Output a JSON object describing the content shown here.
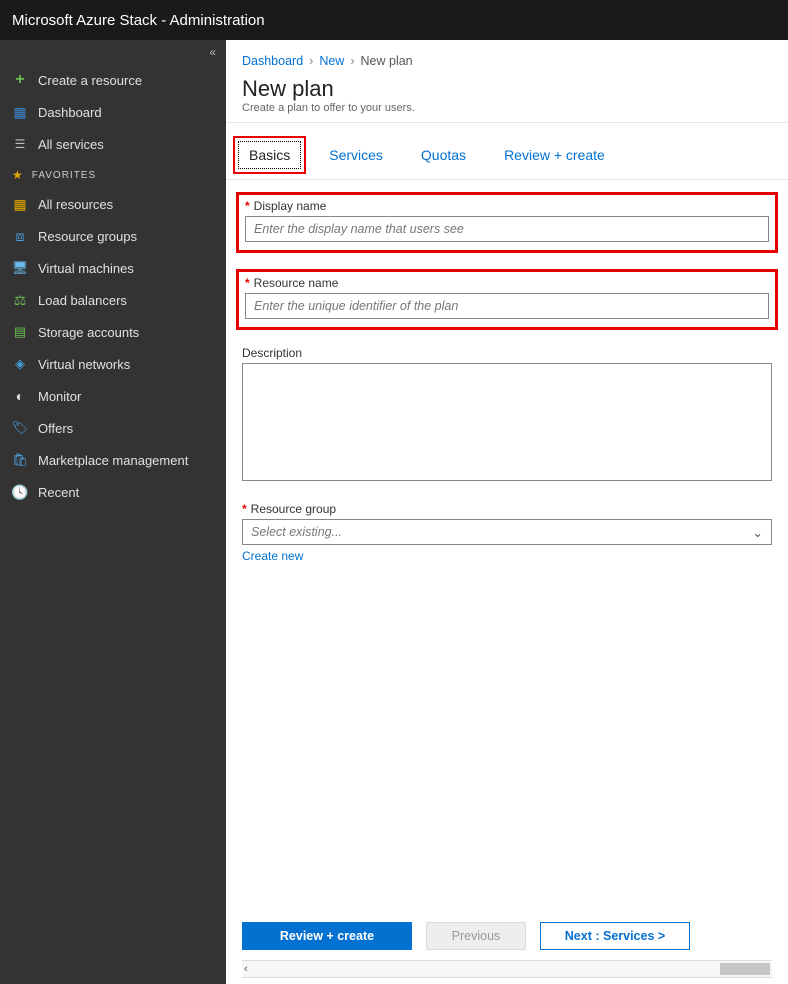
{
  "app_title": "Microsoft Azure Stack - Administration",
  "sidebar": {
    "create_label": "Create a resource",
    "dashboard_label": "Dashboard",
    "all_services_label": "All services",
    "favorites_header": "FAVORITES",
    "items": [
      "All resources",
      "Resource groups",
      "Virtual machines",
      "Load balancers",
      "Storage accounts",
      "Virtual networks",
      "Monitor",
      "Offers",
      "Marketplace management",
      "Recent"
    ]
  },
  "breadcrumb": {
    "root": "Dashboard",
    "mid": "New",
    "current": "New plan"
  },
  "title": "New plan",
  "subtitle": "Create a plan to offer to your users.",
  "tabs": {
    "basics": "Basics",
    "services": "Services",
    "quotas": "Quotas",
    "review": "Review + create"
  },
  "form": {
    "display_name_label": "Display name",
    "display_name_ph": "Enter the display name that users see",
    "resource_name_label": "Resource name",
    "resource_name_ph": "Enter the unique identifier of the plan",
    "description_label": "Description",
    "resource_group_label": "Resource group",
    "resource_group_ph": "Select existing...",
    "create_new_link": "Create new"
  },
  "footer": {
    "review": "Review + create",
    "previous": "Previous",
    "next": "Next : Services >"
  }
}
